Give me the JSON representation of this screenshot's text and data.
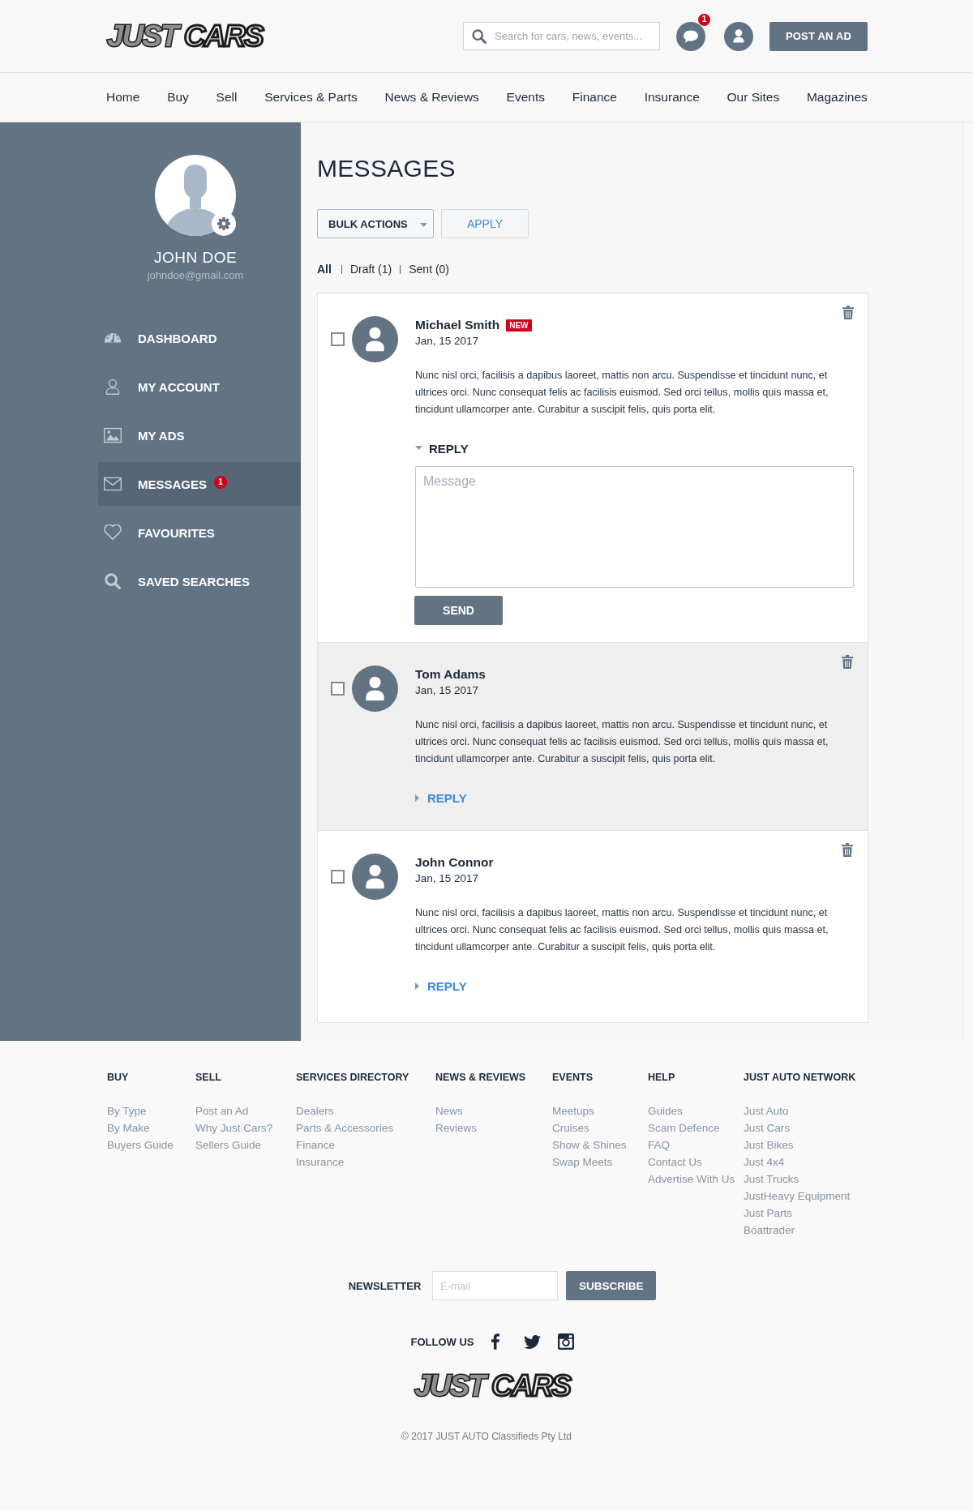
{
  "header": {
    "logo": [
      "JUST",
      "CARS"
    ],
    "search": {
      "placeholder": "Search for cars, news, events..."
    },
    "chat_badge": "1",
    "post_button": "POST AN AD"
  },
  "nav": [
    "Home",
    "Buy",
    "Sell",
    "Services & Parts",
    "News & Reviews",
    "Events",
    "Finance",
    "Insurance",
    "Our Sites",
    "Magazines"
  ],
  "sidebar": {
    "user": {
      "name": "JOHN DOE",
      "email": "johndoe@gmail.com"
    },
    "items": [
      {
        "label": "DASHBOARD",
        "selected": false
      },
      {
        "label": "MY ACCOUNT",
        "selected": false
      },
      {
        "label": "MY ADS",
        "selected": false
      },
      {
        "label": "MESSAGES",
        "selected": true,
        "badge": "1"
      },
      {
        "label": "FAVOURITES",
        "selected": false
      },
      {
        "label": "SAVED SEARCHES",
        "selected": false
      }
    ]
  },
  "main": {
    "title": "MESSAGES",
    "bulk_actions": "BULK ACTIONS",
    "apply_button": "APPLY",
    "filters": [
      {
        "label": "All",
        "selected": true
      },
      {
        "label": "Draft (1)",
        "selected": false
      },
      {
        "label": "Sent (0)",
        "selected": false
      }
    ],
    "messages": [
      {
        "sender": "Michael Smith",
        "badge": "NEW",
        "date": "Jan, 15 2017",
        "body": "Nunc nisl orci, facilisis a dapibus laoreet, mattis non arcu. Suspendisse et tincidunt nunc, et ultrices orci. Nunc consequat felis ac facilisis euismod. Sed orci tellus, mollis quis massa et, tincidunt ullamcorper ante. Curabitur a suscipit felis, quis porta elit.",
        "checked": false,
        "selected": false,
        "reply": {
          "label": "REPLY",
          "expanded": true,
          "placeholder": "Message",
          "send_button": "SEND"
        }
      },
      {
        "sender": "Tom Adams",
        "date": "Jan, 15 2017",
        "body": "Nunc nisl orci, facilisis a dapibus laoreet, mattis non arcu. Suspendisse et tincidunt nunc, et ultrices orci. Nunc consequat felis ac facilisis euismod. Sed orci tellus, mollis quis massa et, tincidunt ullamcorper ante. Curabitur a suscipit felis, quis porta elit.",
        "checked": false,
        "selected": true,
        "reply": {
          "label": "REPLY",
          "expanded": false
        }
      },
      {
        "sender": "John Connor",
        "date": "Jan, 15 2017",
        "body": "Nunc nisl orci, facilisis a dapibus laoreet, mattis non arcu. Suspendisse et tincidunt nunc, et ultrices orci. Nunc consequat felis ac facilisis euismod. Sed orci tellus, mollis quis massa et, tincidunt ullamcorper ante. Curabitur a suscipit felis, quis porta elit.",
        "checked": false,
        "selected": false,
        "reply": {
          "label": "REPLY",
          "expanded": false
        }
      }
    ]
  },
  "footer": {
    "columns": [
      {
        "title": "BUY",
        "links": [
          "By Type",
          "By Make",
          "Buyers Guide"
        ]
      },
      {
        "title": "SELL",
        "links": [
          "Post an Ad",
          "Why Just Cars?",
          "Sellers Guide"
        ]
      },
      {
        "title": "SERVICES DIRECTORY",
        "links": [
          "Dealers",
          "Parts & Accessories",
          "Finance",
          "Insurance"
        ]
      },
      {
        "title": "NEWS & REVIEWS",
        "links": [
          "News",
          "Reviews"
        ]
      },
      {
        "title": "EVENTS",
        "links": [
          "Meetups",
          "Cruises",
          "Show & Shines",
          "Swap Meets"
        ]
      },
      {
        "title": "HELP",
        "links": [
          "Guides",
          "Scam Defence",
          "FAQ",
          "Contact Us",
          "Advertise With Us"
        ]
      },
      {
        "title": "JUST AUTO NETWORK",
        "links": [
          "Just Auto",
          "Just Cars",
          "Just Bikes",
          "Just 4x4",
          "Just Trucks",
          "JustHeavy Equipment",
          "Just Parts",
          "Boattrader"
        ]
      }
    ],
    "newsletter": {
      "label": "NEWSLETTER",
      "placeholder": "E-mail",
      "button": "SUBSCRIBE"
    },
    "follow_label": "FOLLOW US",
    "logo": [
      "JUST",
      "CARS"
    ],
    "copyright": "© 2017 JUST AUTO Classifieds Pty Ltd"
  }
}
